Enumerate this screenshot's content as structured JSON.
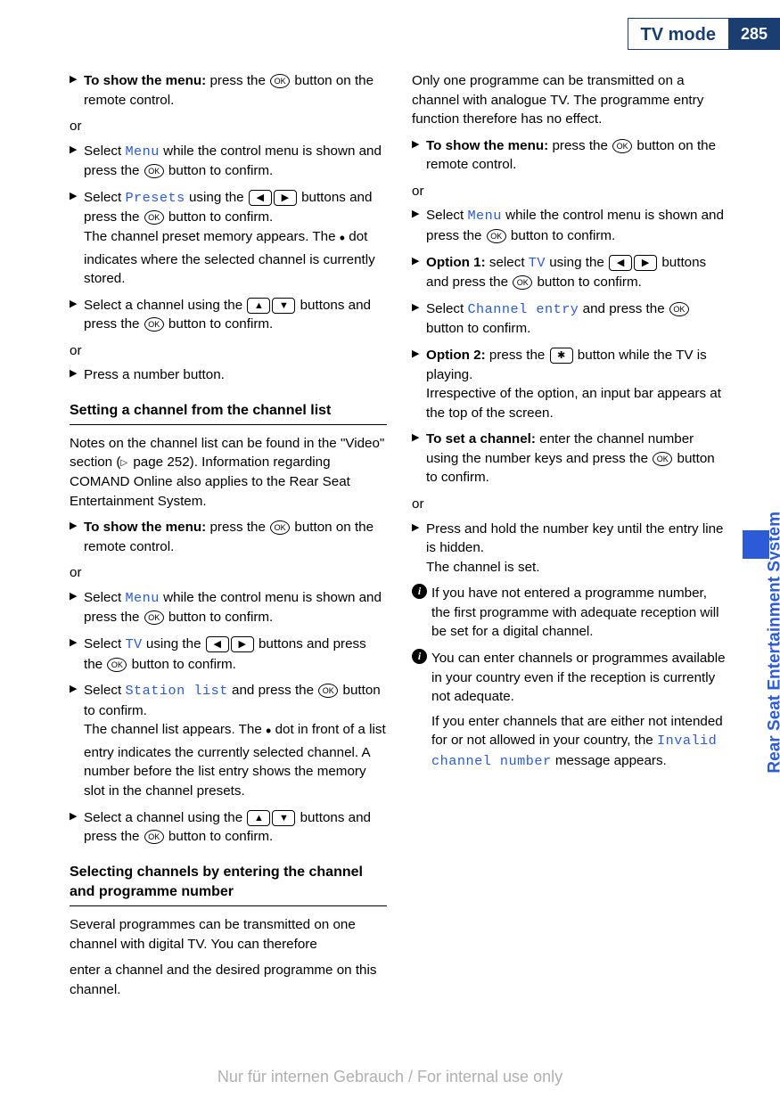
{
  "header": {
    "title": "TV mode",
    "page": "285"
  },
  "side_tab": "Rear Seat Entertainment System",
  "icons": {
    "ok": "OK",
    "left": "◀",
    "right": "▶",
    "up": "▲",
    "down": "▼",
    "star": "✱",
    "info": "i",
    "arrow": "▶",
    "dot": "•"
  },
  "col1": {
    "s1_a": "To show the menu:",
    "s1_b": " press the ",
    "s1_c": " button on the remote control.",
    "or1": "or",
    "s2_a": "Select ",
    "s2_menu": "Menu",
    "s2_b": " while the control menu is shown and press the ",
    "s2_c": " button to confirm.",
    "s3_a": "Select ",
    "s3_presets": "Presets",
    "s3_b": " using the ",
    "s3_c": " buttons and press the ",
    "s3_d": " button to confirm.",
    "s3_e": "The channel preset memory appears. The ",
    "s3_f": " dot indicates where the selected channel is currently stored.",
    "s4_a": "Select a channel using the ",
    "s4_b": " buttons and press the ",
    "s4_c": " button to confirm.",
    "or2": "or",
    "s5": "Press a number button.",
    "h1": "Setting a channel from the channel list",
    "p1_a": "Notes on the channel list can be found in the \"Video\" section (",
    "p1_b": " page 252). Information regarding COMAND Online also applies to the Rear Seat Entertainment System.",
    "s6_a": "To show the menu:",
    "s6_b": " press the ",
    "s6_c": " button on the remote control.",
    "or3": "or",
    "s7_a": "Select ",
    "s7_menu": "Menu",
    "s7_b": " while the control menu is shown and press the ",
    "s7_c": " button to confirm.",
    "s8_a": "Select ",
    "s8_tv": "TV",
    "s8_b": " using the ",
    "s8_c": " buttons and press the ",
    "s8_d": " button to confirm.",
    "s9_a": "Select ",
    "s9_sl": "Station list",
    "s9_b": " and press the ",
    "s9_c": " button to confirm.",
    "s9_d": "The channel list appears. The ",
    "s9_e": " dot in front of a list entry indicates the currently selected channel. A number before the list entry shows the memory slot in the channel presets.",
    "s10_a": "Select a channel using the ",
    "s10_b": " buttons and press the ",
    "s10_c": " button to confirm.",
    "h2": "Selecting channels by entering the channel and programme number",
    "p2": "Several programmes can be transmitted on one channel with digital TV. You can therefore"
  },
  "col2": {
    "p3": "enter a channel and the desired programme on this channel.",
    "p4": "Only one programme can be transmitted on a channel with analogue TV. The programme entry function therefore has no effect.",
    "s11_a": "To show the menu:",
    "s11_b": " press the ",
    "s11_c": " button on the remote control.",
    "or4": "or",
    "s12_a": "Select ",
    "s12_menu": "Menu",
    "s12_b": " while the control menu is shown and press the ",
    "s12_c": " button to confirm.",
    "s13_a": "Option 1:",
    "s13_b": " select ",
    "s13_tv": "TV",
    "s13_c": " using the ",
    "s13_d": " buttons and press the ",
    "s13_e": " button to confirm.",
    "s14_a": "Select ",
    "s14_ce": "Channel entry",
    "s14_b": " and press the ",
    "s14_c": " button to confirm.",
    "s15_a": "Option 2:",
    "s15_b": " press the ",
    "s15_c": " button while the TV is playing.",
    "s15_d": "Irrespective of the option, an input bar appears at the top of the screen.",
    "s16_a": "To set a channel:",
    "s16_b": " enter the channel number using the number keys and press the ",
    "s16_c": " button to confirm.",
    "or5": "or",
    "s17_a": "Press and hold the number key until the entry line is hidden.",
    "s17_b": "The channel is set.",
    "i1": "If you have not entered a programme number, the first programme with adequate reception will be set for a digital channel.",
    "i2_a": "You can enter channels or programmes available in your country even if the reception is currently not adequate.",
    "i2_b": "If you enter channels that are either not intended for or not allowed in your country, the ",
    "i2_inv": "Invalid channel number",
    "i2_c": " message appears."
  },
  "footer": "Nur für internen Gebrauch / For internal use only"
}
